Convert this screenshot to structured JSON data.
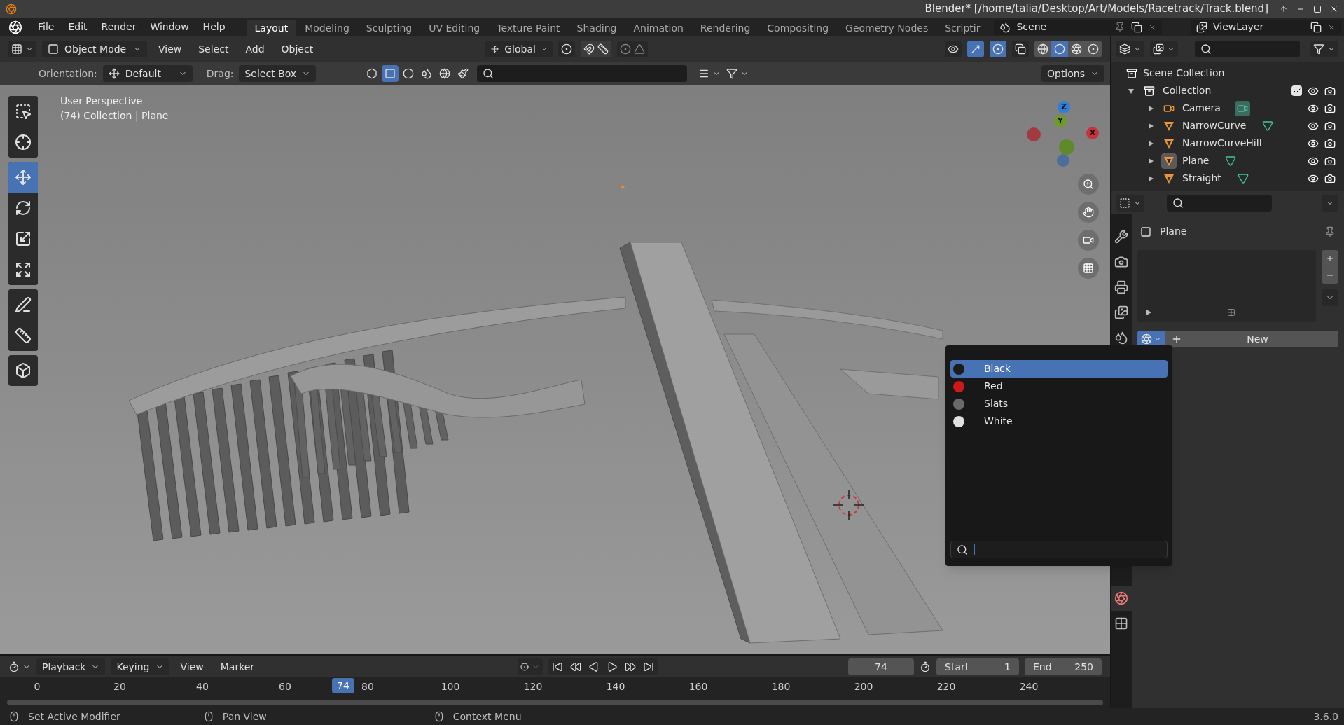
{
  "window": {
    "title": "Blender* [/home/talia/Desktop/Art/Models/Racetrack/Track.blend]"
  },
  "menu": [
    "File",
    "Edit",
    "Render",
    "Window",
    "Help"
  ],
  "workspaces": [
    {
      "label": "Layout",
      "selected": true
    },
    {
      "label": "Modeling",
      "selected": false
    },
    {
      "label": "Sculpting",
      "selected": false
    },
    {
      "label": "UV Editing",
      "selected": false
    },
    {
      "label": "Texture Paint",
      "selected": false
    },
    {
      "label": "Shading",
      "selected": false
    },
    {
      "label": "Animation",
      "selected": false
    },
    {
      "label": "Rendering",
      "selected": false
    },
    {
      "label": "Compositing",
      "selected": false
    },
    {
      "label": "Geometry Nodes",
      "selected": false
    },
    {
      "label": "Scriptir",
      "selected": false
    }
  ],
  "scene": "Scene",
  "view_layer": "ViewLayer",
  "viewport_header": {
    "mode": "Object Mode",
    "menus": [
      "View",
      "Select",
      "Add",
      "Object"
    ],
    "orientation": "Global",
    "toggles": [
      {
        "kind": "visibility",
        "on": false
      },
      {
        "kind": "gizmos",
        "on": true
      },
      {
        "kind": "overlays",
        "on": true
      },
      {
        "kind": "xray",
        "on": false
      }
    ],
    "shading": [
      {
        "kind": "wireframe",
        "selected": false
      },
      {
        "kind": "solid",
        "selected": true
      },
      {
        "kind": "material",
        "selected": false
      },
      {
        "kind": "rendered",
        "selected": false
      }
    ]
  },
  "tool_settings": {
    "orientation_label": "Orientation:",
    "orientation": "Default",
    "drag_label": "Drag:",
    "drag": "Select Box",
    "options": "Options",
    "select_modes": [
      {
        "kind": "all",
        "selected": false
      },
      {
        "kind": "box",
        "selected": true
      },
      {
        "kind": "shade",
        "selected": false
      },
      {
        "kind": "drops",
        "selected": false
      },
      {
        "kind": "globe",
        "selected": false
      },
      {
        "kind": "brush",
        "selected": false
      }
    ]
  },
  "toolbar": [
    {
      "tools": [
        {
          "kind": "select",
          "selected": false
        },
        {
          "kind": "cursor",
          "selected": false
        }
      ]
    },
    {
      "tools": [
        {
          "kind": "move",
          "selected": true
        },
        {
          "kind": "rotate",
          "selected": false
        },
        {
          "kind": "scale",
          "selected": false
        },
        {
          "kind": "transform",
          "selected": false
        }
      ]
    },
    {
      "tools": [
        {
          "kind": "annotate",
          "selected": false
        },
        {
          "kind": "measure",
          "selected": false
        }
      ]
    },
    {
      "tools": [
        {
          "kind": "add_cube",
          "selected": false
        }
      ]
    }
  ],
  "viewport": {
    "view_name": "User Perspective",
    "context": "(74) Collection | Plane",
    "gizmo": [
      {
        "label": "Z",
        "color": "#2f7fd8"
      },
      {
        "label": "Y",
        "color": "#6e9a2c"
      },
      {
        "label": "X",
        "color": "#c8323c"
      }
    ]
  },
  "outliner": {
    "root": "Scene Collection",
    "items": [
      {
        "name": "Collection",
        "kind": "collection",
        "expanded": true,
        "checked": true,
        "children": [
          {
            "name": "Camera",
            "kind": "camera",
            "expanded": false,
            "active": false,
            "data_icon": true
          },
          {
            "name": "NarrowCurve",
            "kind": "mesh",
            "expanded": false,
            "active": false,
            "data_icon": true
          },
          {
            "name": "NarrowCurveHill",
            "kind": "mesh",
            "expanded": false,
            "active": false,
            "data_icon": false
          },
          {
            "name": "Plane",
            "kind": "mesh",
            "expanded": false,
            "active": true,
            "data_icon": true
          },
          {
            "name": "Straight",
            "kind": "mesh",
            "expanded": false,
            "active": false,
            "data_icon": true
          }
        ]
      }
    ]
  },
  "properties": {
    "tabs": [
      {
        "kind": "tool",
        "selected": false
      },
      {
        "kind": "render",
        "selected": false
      },
      {
        "kind": "output",
        "selected": false
      },
      {
        "kind": "view_layer",
        "selected": false
      },
      {
        "kind": "scene",
        "selected": false
      },
      {
        "kind": "material",
        "selected": true
      },
      {
        "kind": "texture",
        "selected": false
      }
    ],
    "object": "Plane",
    "new_button": "New"
  },
  "material_menu": {
    "items": [
      {
        "name": "Black",
        "selected": true,
        "color": "#1c1c1c"
      },
      {
        "name": "Red",
        "selected": false,
        "color": "#d01818"
      },
      {
        "name": "Slats",
        "selected": false,
        "color": "#6a6a6a"
      },
      {
        "name": "White",
        "selected": false,
        "color": "#e0e0e0"
      }
    ]
  },
  "timeline": {
    "menus": [
      "Playback",
      "Keying",
      "View",
      "Marker"
    ],
    "current_frame": "74",
    "start_label": "Start",
    "start": "1",
    "end_label": "End",
    "end": "250",
    "ticks": [
      "0",
      "20",
      "40",
      "60",
      "80",
      "100",
      "120",
      "140",
      "160",
      "180",
      "200",
      "220",
      "240"
    ],
    "playhead": "74"
  },
  "status_bar": {
    "hints": [
      "Set Active Modifier",
      "Pan View",
      "Context Menu"
    ],
    "version": "3.6.0"
  }
}
